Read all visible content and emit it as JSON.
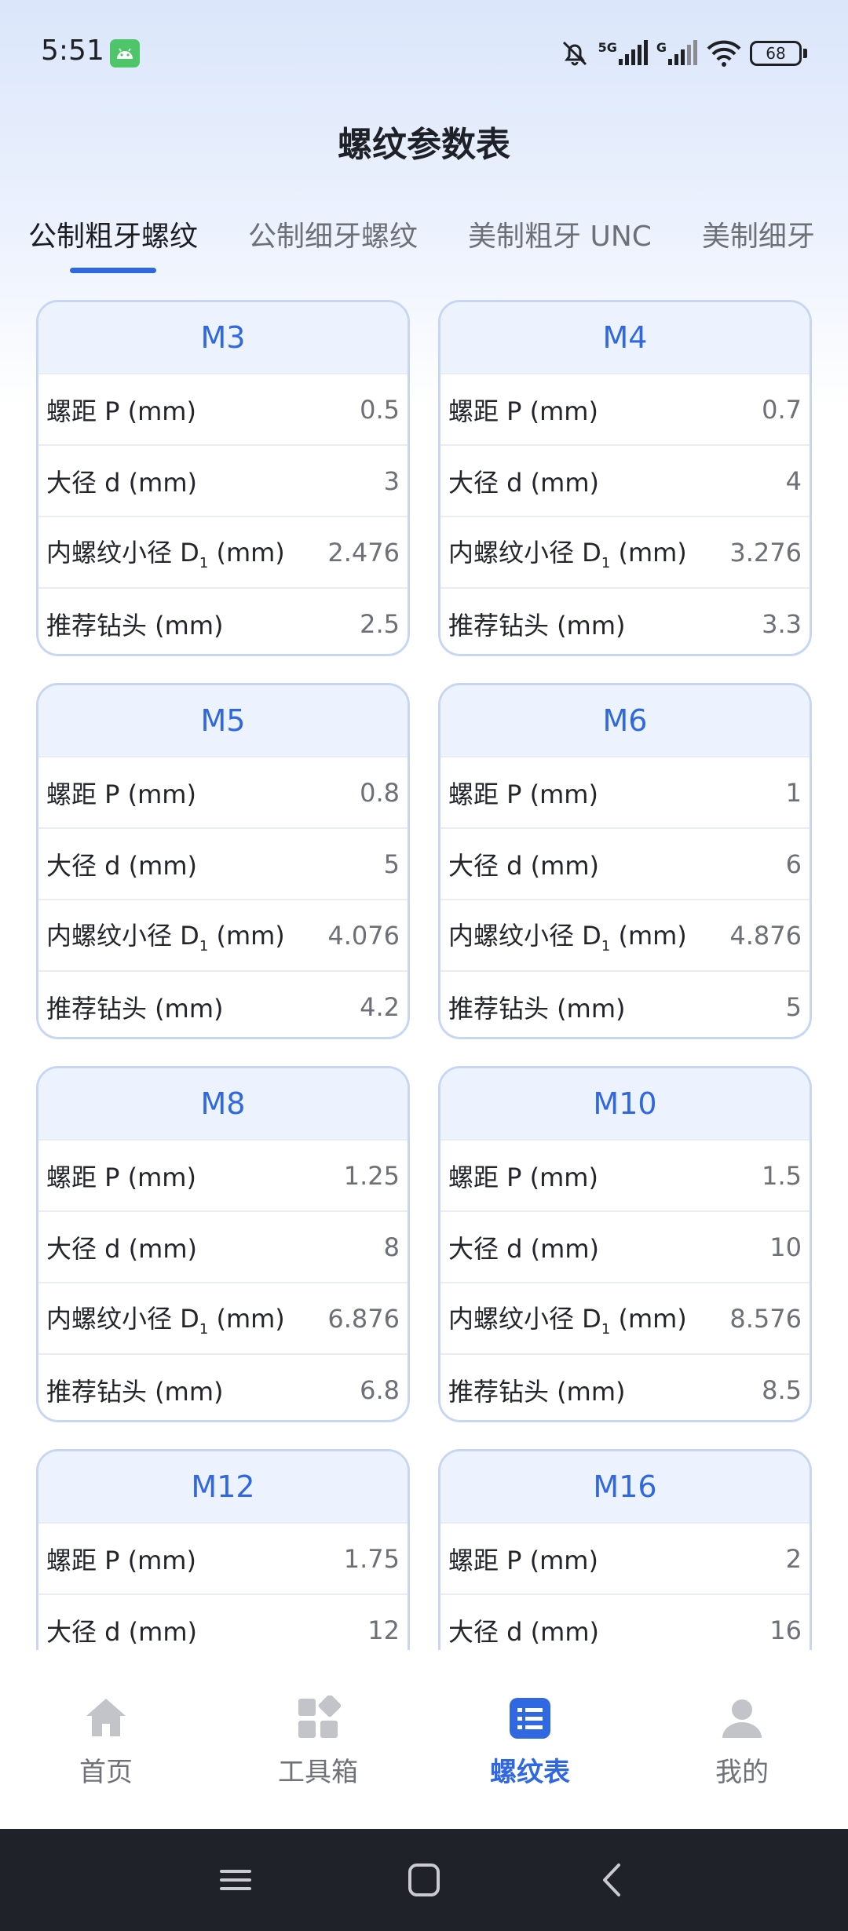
{
  "status_bar": {
    "time": "5:51",
    "network_5g": "5G",
    "network_g": "G",
    "battery": "68"
  },
  "page_title": "螺纹参数表",
  "tabs": [
    {
      "label": "公制粗牙螺纹",
      "active": true
    },
    {
      "label": "公制细牙螺纹",
      "active": false
    },
    {
      "label": "美制粗牙 UNC",
      "active": false
    },
    {
      "label": "美制细牙",
      "active": false
    }
  ],
  "row_labels": {
    "pitch": "螺距 P (mm)",
    "major": "大径 d (mm)",
    "minor_prefix": "内螺纹小径 D",
    "minor_sub": "1",
    "minor_suffix": " (mm)",
    "drill": "推荐钻头 (mm)"
  },
  "cards": [
    {
      "name": "M3",
      "pitch": "0.5",
      "major": "3",
      "minor": "2.476",
      "drill": "2.5"
    },
    {
      "name": "M4",
      "pitch": "0.7",
      "major": "4",
      "minor": "3.276",
      "drill": "3.3"
    },
    {
      "name": "M5",
      "pitch": "0.8",
      "major": "5",
      "minor": "4.076",
      "drill": "4.2"
    },
    {
      "name": "M6",
      "pitch": "1",
      "major": "6",
      "minor": "4.876",
      "drill": "5"
    },
    {
      "name": "M8",
      "pitch": "1.25",
      "major": "8",
      "minor": "6.876",
      "drill": "6.8"
    },
    {
      "name": "M10",
      "pitch": "1.5",
      "major": "10",
      "minor": "8.576",
      "drill": "8.5"
    },
    {
      "name": "M12",
      "pitch": "1.75",
      "major": "12"
    },
    {
      "name": "M16",
      "pitch": "2",
      "major": "16"
    }
  ],
  "bottom_nav": [
    {
      "label": "首页",
      "icon": "home-icon",
      "active": false
    },
    {
      "label": "工具箱",
      "icon": "toolbox-icon",
      "active": false
    },
    {
      "label": "螺纹表",
      "icon": "list-icon",
      "active": true
    },
    {
      "label": "我的",
      "icon": "person-icon",
      "active": false
    }
  ],
  "colors": {
    "accent": "#2f68e0",
    "card_border": "#c7d7f3",
    "card_header_bg": "#edf3fe",
    "system_nav_bg": "#1f2329"
  }
}
